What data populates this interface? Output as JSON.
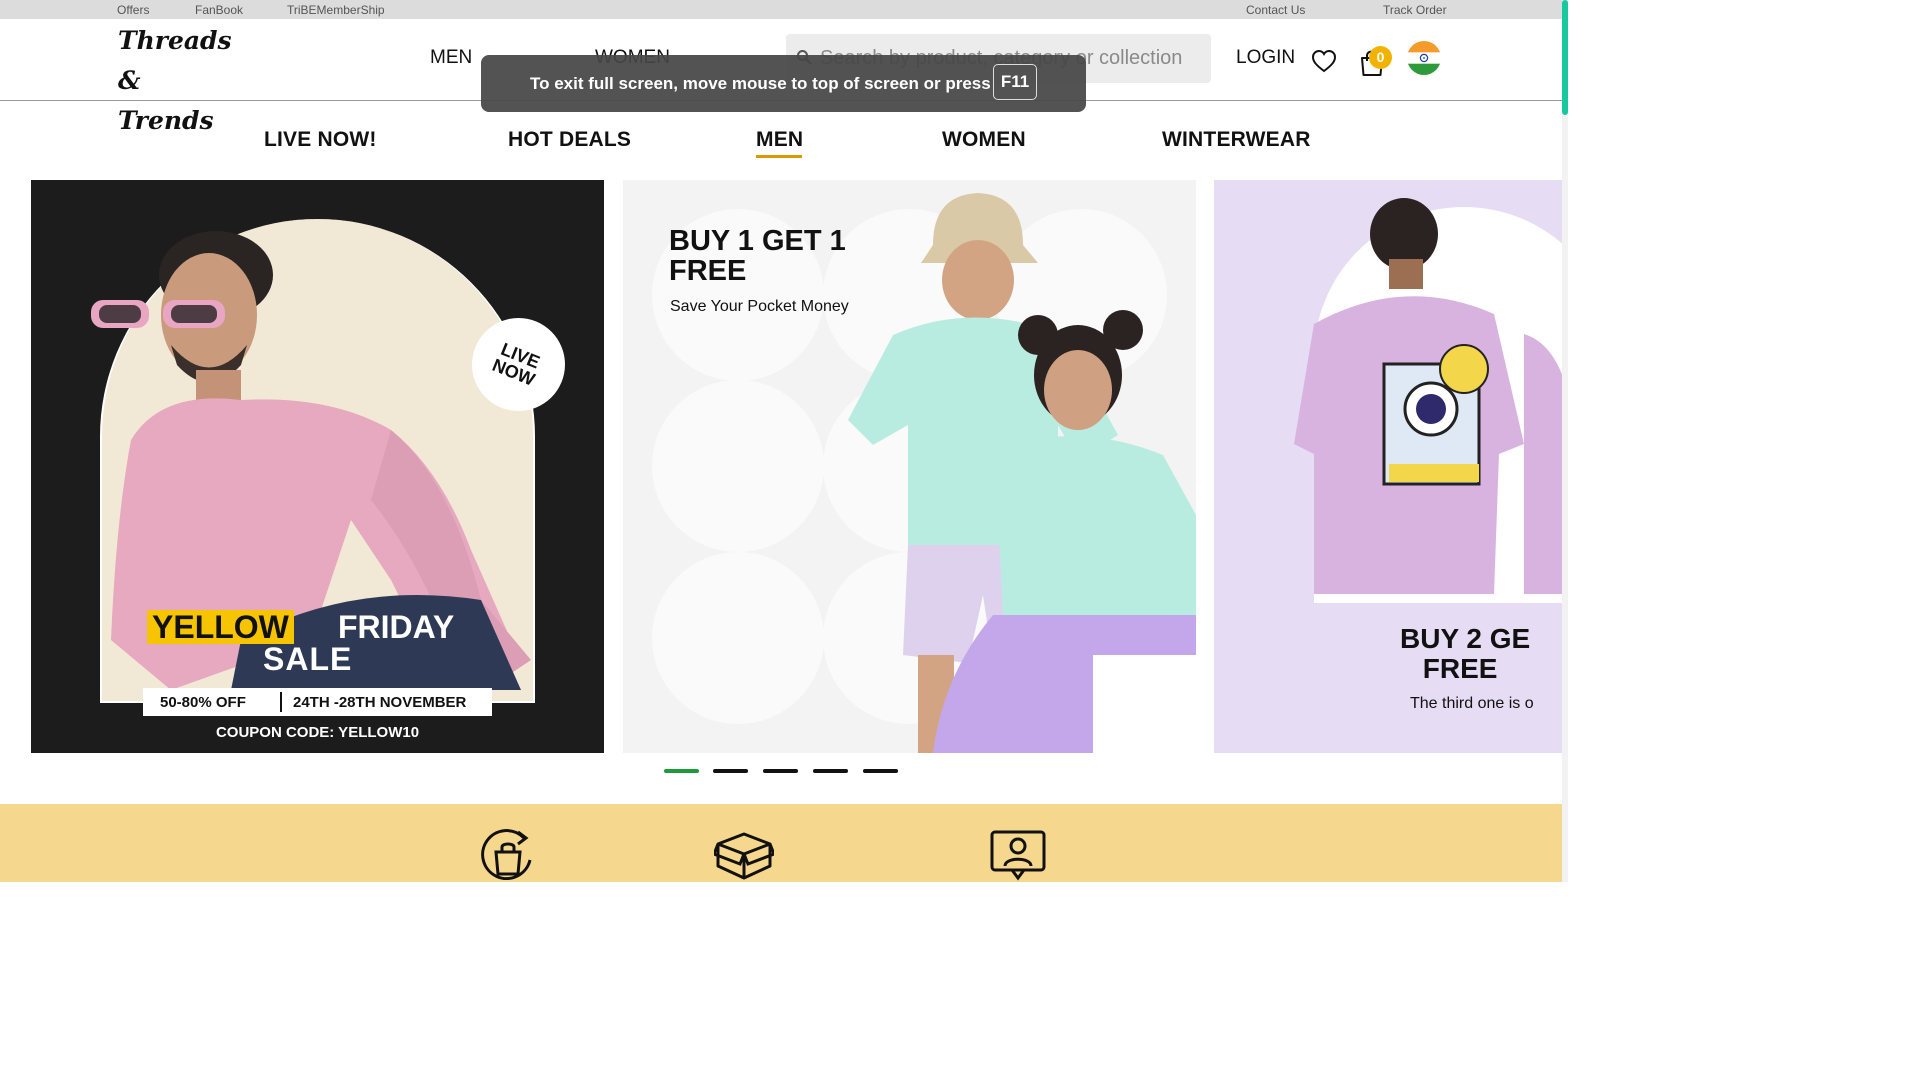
{
  "topbar": {
    "left_links": [
      "Offers",
      "FanBook",
      "TriBEMemberShip"
    ],
    "right_links": [
      "Contact Us",
      "Track Order"
    ]
  },
  "header": {
    "logo_line1": "Threads &",
    "logo_line2": "Trends",
    "nav": [
      "MEN",
      "WOMEN"
    ],
    "search_placeholder": "Search by product, category or collection",
    "login_label": "LOGIN",
    "cart_count": "0"
  },
  "fullscreen_notice": {
    "message": "To exit full screen, move mouse to top of screen or press",
    "key": "F11"
  },
  "category_nav": {
    "items": [
      "LIVE NOW!",
      "HOT DEALS",
      "MEN",
      "WOMEN",
      "WINTERWEAR"
    ],
    "active": "MEN"
  },
  "banners": {
    "b1": {
      "badge": "LIVE NOW",
      "title_highlight": "YELLOW",
      "title_rest": "FRIDAY",
      "title_line2": "SALE",
      "discount": "50-80% OFF",
      "dates": "24TH -28TH NOVEMBER",
      "coupon": "COUPON CODE: YELLOW10"
    },
    "b2": {
      "title": "BUY 1 GET 1 FREE",
      "subtitle": "Save Your Pocket Money"
    },
    "b3": {
      "title_line1": "BUY 2 GE",
      "title_line2": "FREE",
      "subtitle": "The third one is o"
    }
  },
  "carousel": {
    "count": 5,
    "active_index": 0
  },
  "colors": {
    "accent_yellow": "#f6c400",
    "underline": "#d99a00",
    "active_dot": "#1f9a3a",
    "features_bg": "#f6d78e",
    "badge": "#f2b300"
  },
  "icons": [
    "search-icon",
    "heart-icon",
    "shopping-bag-icon",
    "india-flag-icon",
    "return-bag-icon",
    "open-box-icon",
    "user-badge-icon"
  ]
}
